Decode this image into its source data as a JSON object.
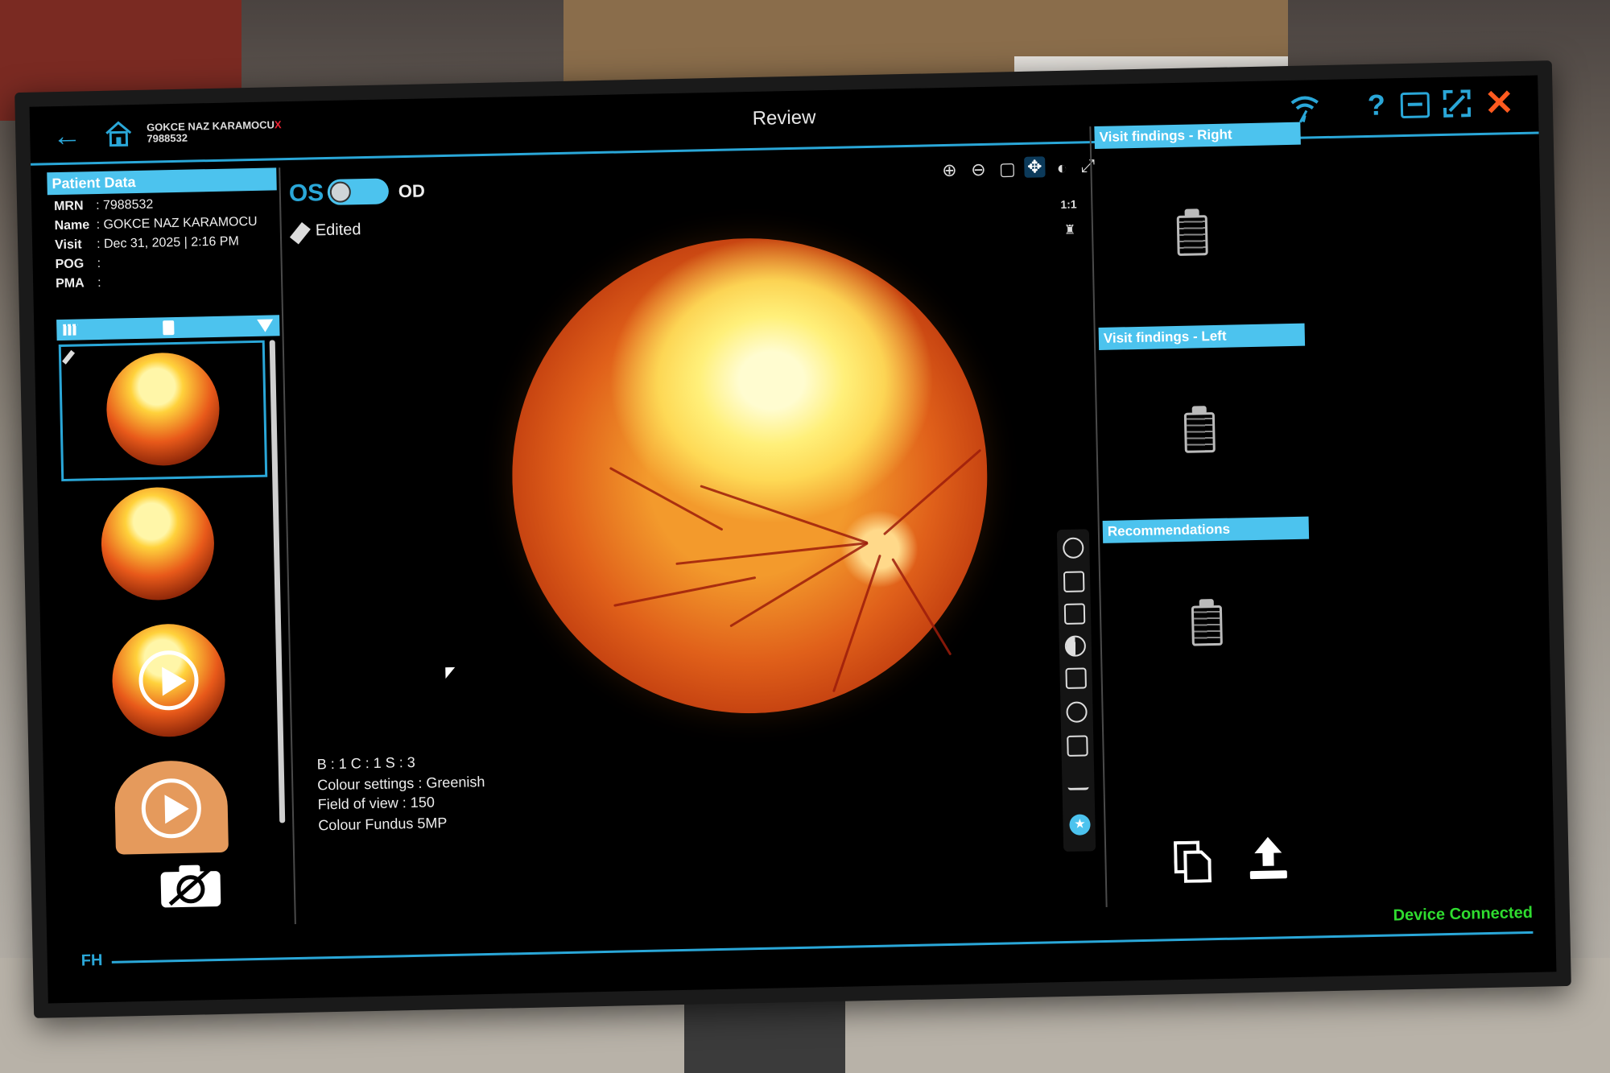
{
  "window": {
    "title": "Review",
    "patient_header": "GOKCE NAZ KARAMOCU",
    "patient_header_id": "7988532",
    "close_mark": "X"
  },
  "colors": {
    "accent": "#2aa7d8",
    "header_bar": "#4cc3ee",
    "close": "#ff5a1f",
    "status_ok": "#2fdc2f"
  },
  "patient_data": {
    "header": "Patient Data",
    "mrn_label": "MRN",
    "mrn": ": 7988532",
    "name_label": "Name",
    "name": ": GOKCE NAZ KARAMOCU",
    "visit_label": "Visit",
    "visit": ": Dec 31, 2025 | 2:16 PM",
    "pog_label": "POG",
    "pog": ":",
    "pma_label": "PMA",
    "pma": ":"
  },
  "eye_toggle": {
    "left": "OS",
    "right": "OD"
  },
  "edit_status": "Edited",
  "zoom_ratio": "1:1",
  "image_info": {
    "bcs": "B : 1  C : 1  S : 3",
    "colour_settings_label": "Colour settings",
    "colour_settings": ": Greenish",
    "fov_label": "Field of view",
    "fov": ": 150",
    "mode": "Colour Fundus  5MP"
  },
  "right_panel": {
    "findings_right": "Visit findings - Right",
    "findings_left": "Visit findings - Left",
    "recommendations": "Recommendations"
  },
  "footer": {
    "status": "Device Connected",
    "brand": "FH"
  },
  "icons": [
    "back-icon",
    "home-icon",
    "wifi-icon",
    "help-icon",
    "minimize-icon",
    "maximize-icon",
    "close-icon",
    "zoom-in-icon",
    "zoom-out-icon",
    "fit-icon",
    "pan-icon",
    "compare-icon",
    "fullscreen-icon",
    "grid-icon",
    "trash-icon",
    "filter-icon",
    "play-icon",
    "no-camera-icon",
    "clipboard-icon",
    "copy-icon",
    "upload-icon",
    "star-icon"
  ]
}
